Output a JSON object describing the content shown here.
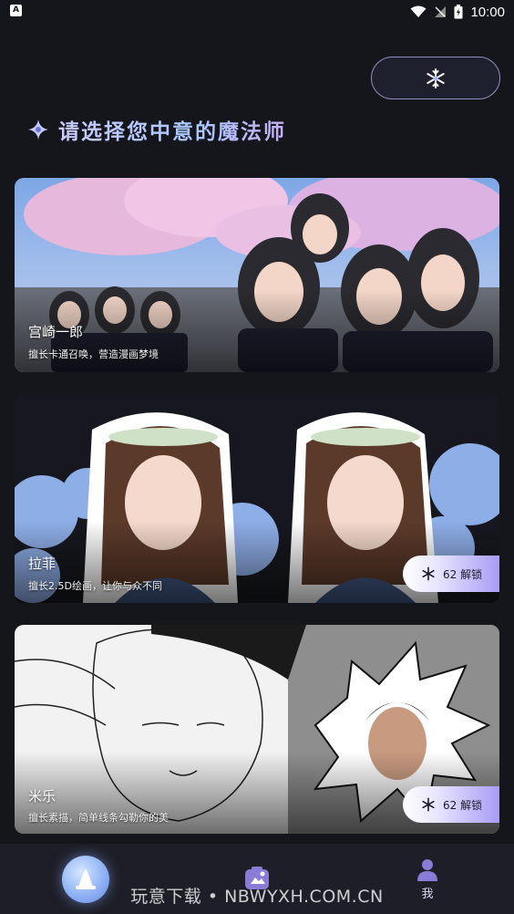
{
  "status_bar": {
    "app_icon": "A",
    "time": "10:00",
    "icons": [
      "wifi-icon",
      "signal-icon",
      "battery-icon"
    ]
  },
  "top_button": {
    "icon": "snowflake-icon"
  },
  "heading": {
    "title": "请选择您中意的魔法师",
    "icon": "sparkle-icon"
  },
  "cards": [
    {
      "title": "宫崎一郎",
      "desc": "擅长卡通召唤，营造漫画梦境",
      "unlock": null
    },
    {
      "title": "拉菲",
      "desc": "擅长2.5D绘画，让你与众不同",
      "unlock": "62 解锁"
    },
    {
      "title": "米乐",
      "desc": "擅长素描，简单线条勾勒你的美",
      "unlock": "62 解锁"
    }
  ],
  "bottom_nav": {
    "items": [
      {
        "name": "home",
        "icon": "wizard-hat-icon",
        "label": ""
      },
      {
        "name": "works",
        "icon": "image-frame-icon",
        "label": ""
      },
      {
        "name": "profile",
        "icon": "user-icon",
        "label": "我"
      }
    ]
  },
  "watermark": "玩意下载 • NBWYXH.COM.CN",
  "colors": {
    "background": "#15161c",
    "accent": "#a79cf3",
    "nav_background": "#1d1e27"
  }
}
